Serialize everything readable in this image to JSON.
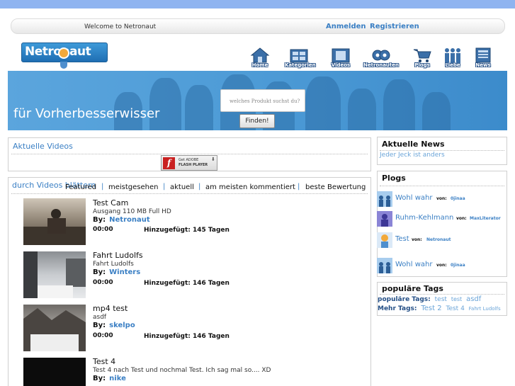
{
  "header": {
    "welcome": "Welcome  to Netronaut",
    "login": "Anmelden",
    "register": "Registrieren"
  },
  "logo": {
    "text": "Netronaut"
  },
  "nav": [
    {
      "label": "Home",
      "icon": "house-icon"
    },
    {
      "label": "Kategorien",
      "icon": "categories-icon"
    },
    {
      "label": "Videos",
      "icon": "film-icon"
    },
    {
      "label": "Netronauten",
      "icon": "robots-icon"
    },
    {
      "label": "Plogs",
      "icon": "cart-icon"
    },
    {
      "label": "Liebe",
      "icon": "people-icon"
    },
    {
      "label": "News",
      "icon": "newspaper-icon"
    }
  ],
  "banner": {
    "slogan": "für Vorherbesserwisser",
    "search_placeholder": "welches Produkt suchst du?",
    "search_button": "Finden!"
  },
  "videos_panel": {
    "title": "Aktuelle Videos",
    "flash_line1": "Get ADOBE",
    "flash_line2": "FLASH PLAYER"
  },
  "browse": {
    "title": "durch Videos blättern",
    "tabs": [
      "Featured",
      "meistgesehen",
      "aktuell",
      "am meisten kommentiert",
      "beste Bewertung"
    ]
  },
  "video_list": [
    {
      "title": "Test Cam",
      "desc": "Ausgang 110 MB Full HD",
      "by": "By:",
      "author": "Netronaut",
      "duration": "00:00",
      "added": "Hinzugefügt: 145 Tagen"
    },
    {
      "title": "Fahrt Ludolfs",
      "desc": "Fahrt Ludolfs",
      "by": "By:",
      "author": "Winters",
      "duration": "00:00",
      "added": "Hinzugefügt: 146 Tagen"
    },
    {
      "title": "mp4 test",
      "desc": "asdf",
      "by": "By:",
      "author": "skelpo",
      "duration": "00:00",
      "added": "Hinzugefügt: 146 Tagen"
    },
    {
      "title": "Test 4",
      "desc": "Test 4 nach Test und nochmal Test. Ich sag mal so.... XD",
      "by": "By:",
      "author": "nike"
    }
  ],
  "news": {
    "title": "Aktuelle News",
    "item": "Jeder Jeck ist anders"
  },
  "plogs": {
    "title": "Plogs",
    "von": "von:",
    "items": [
      {
        "title": "Wohl wahr",
        "user": "0jinaa"
      },
      {
        "title": "Ruhm-Kehlmann",
        "user": "MaxLiterator"
      },
      {
        "title": "Test",
        "user": "Netronaut"
      },
      {
        "title": "Wohl wahr",
        "user": "0jinaa"
      }
    ]
  },
  "tags": {
    "title": "populäre Tags",
    "popular_label": "populäre Tags:",
    "popular": [
      "test",
      "test",
      "asdf"
    ],
    "more_label": "Mehr Tags:",
    "more": [
      "Test 2",
      "Test 4",
      "Fahrt Ludolfs"
    ]
  },
  "colors": {
    "accent": "#3a7fc4",
    "banner": "#4d9bd6",
    "top_band": "#8fb4f0"
  }
}
